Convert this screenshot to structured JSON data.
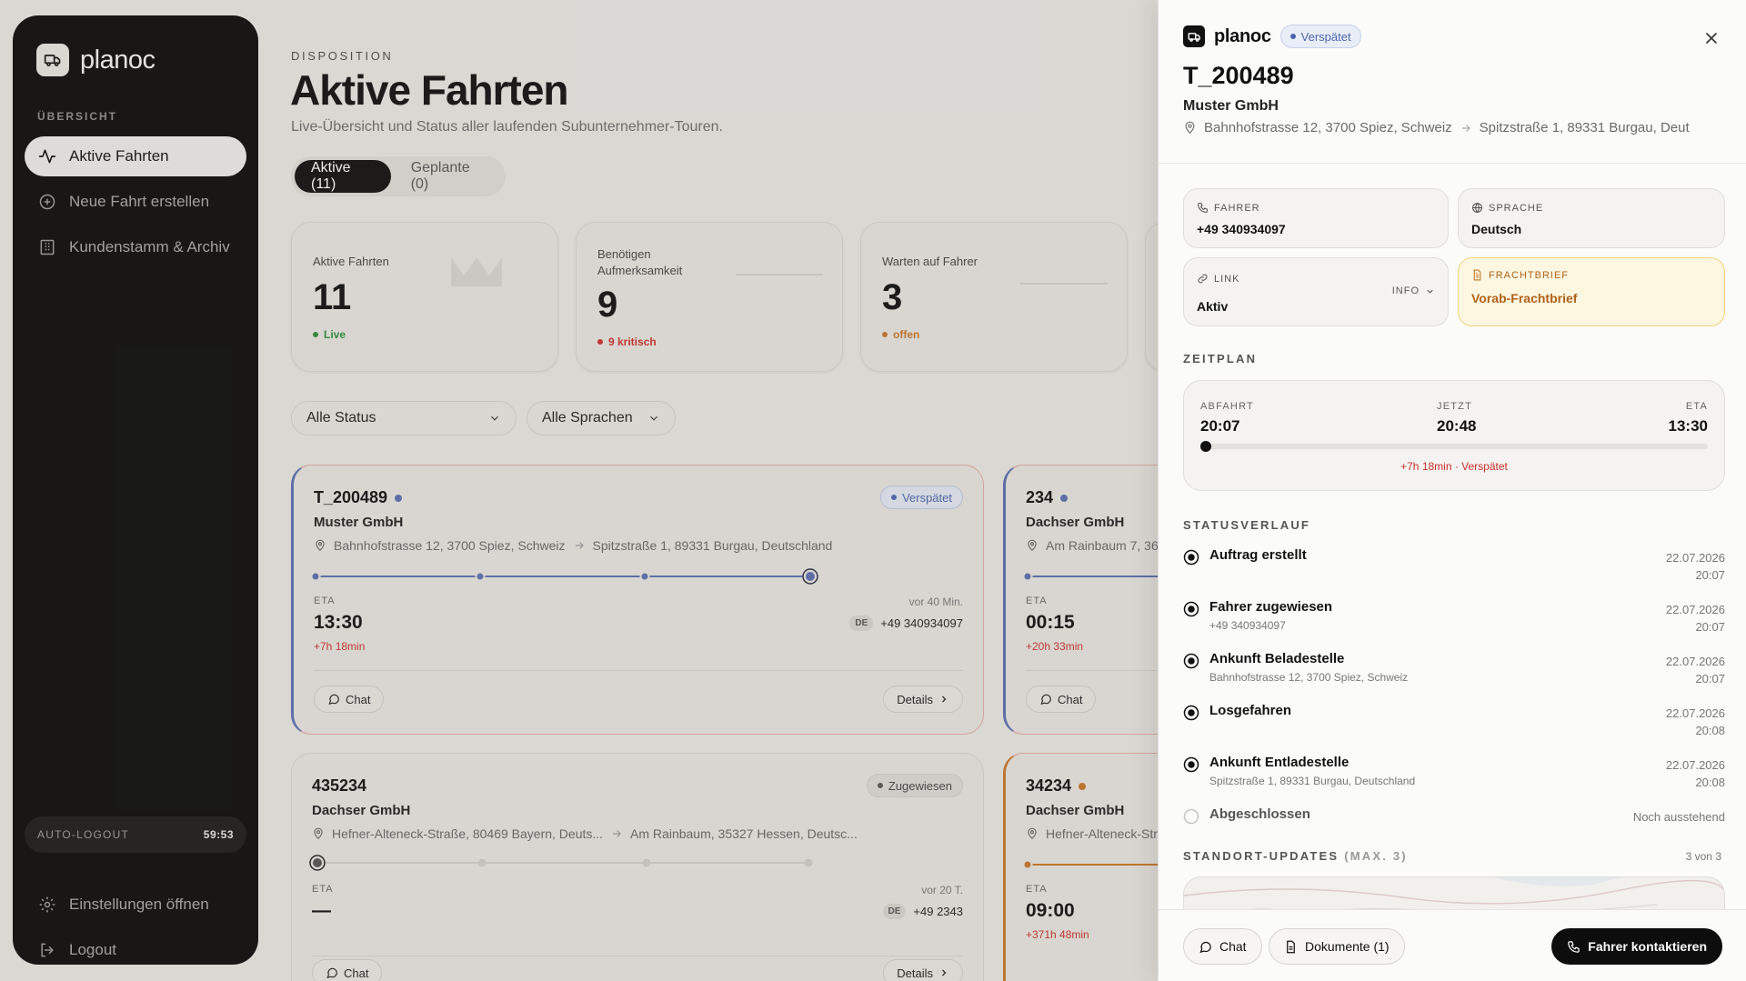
{
  "sidebar": {
    "brand": "planoc",
    "section": "ÜBERSICHT",
    "nav": [
      {
        "label": "Aktive Fahrten"
      },
      {
        "label": "Neue Fahrt erstellen"
      },
      {
        "label": "Kundenstamm & Archiv"
      }
    ],
    "autologout_label": "AUTO-LOGOUT",
    "autologout_time": "59:53",
    "settings": "Einstellungen öffnen",
    "logout": "Logout"
  },
  "main": {
    "kicker": "DISPOSITION",
    "title": "Aktive Fahrten",
    "subtitle": "Live-Übersicht und Status aller laufenden Subunternehmer-Touren.",
    "tabs": [
      "Aktive (11)",
      "Geplante (0)"
    ],
    "stats": [
      {
        "label": "Aktive Fahrten",
        "value": "11",
        "status": "Live",
        "color": "#2e8b3a"
      },
      {
        "label": "Benötigen Aufmerksamkeit",
        "value": "9",
        "status": "9 kritisch",
        "color": "#c9302c"
      },
      {
        "label": "Warten auf Fahrer",
        "value": "3",
        "status": "offen",
        "color": "#c7762a"
      }
    ],
    "filters": [
      "Alle Status",
      "Alle Sprachen"
    ],
    "cards": [
      {
        "id": "T_200489",
        "company": "Muster GmbH",
        "from": "Bahnhofstrasse 12, 3700 Spiez, Schweiz",
        "to": "Spitzstraße 1, 89331 Burgau, Deutschland",
        "badge": "Verspätet",
        "eta_label": "ETA",
        "eta": "13:30",
        "delay": "+7h 18min",
        "ago": "vor 40 Min.",
        "lang": "DE",
        "phone": "+49 340934097",
        "chat": "Chat",
        "details": "Details"
      },
      {
        "id": "234",
        "company": "Dachser GmbH",
        "from": "Am Rainbaum 7, 361",
        "eta_label": "ETA",
        "eta": "00:15",
        "delay": "+20h 33min",
        "chat": "Chat"
      },
      {
        "id": "435234",
        "company": "Dachser GmbH",
        "from": "Hefner-Alteneck-Straße, 80469 Bayern, Deuts...",
        "to": "Am Rainbaum, 35327 Hessen, Deutsc...",
        "badge": "Zugewiesen",
        "eta_label": "ETA",
        "eta": "—",
        "ago": "vor 20 T.",
        "lang": "DE",
        "phone": "+49 2343",
        "chat": "Chat",
        "details": "Details"
      },
      {
        "id": "34234",
        "company": "Dachser GmbH",
        "from": "Hefner-Alteneck-Stra",
        "eta_label": "ETA",
        "eta": "09:00",
        "delay": "+371h 48min"
      }
    ]
  },
  "panel": {
    "brand": "planoc",
    "badge": "Verspätet",
    "id": "T_200489",
    "company": "Muster GmbH",
    "from": "Bahnhofstrasse 12, 3700 Spiez, Schweiz",
    "to": "Spitzstraße 1, 89331 Burgau, Deut",
    "driver_label": "FAHRER",
    "driver": "+49 340934097",
    "language_label": "SPRACHE",
    "language": "Deutsch",
    "link_label": "LINK",
    "link": "Aktiv",
    "info": "INFO",
    "freight_label": "FRACHTBRIEF",
    "freight": "Vorab-Frachtbrief",
    "schedule_title": "ZEITPLAN",
    "departure_label": "ABFAHRT",
    "departure": "20:07",
    "now_label": "JETZT",
    "now": "20:48",
    "eta_label": "ETA",
    "eta": "13:30",
    "progress": 0,
    "delay_text": "+7h 18min · Verspätet",
    "history_title": "STATUSVERLAUF",
    "history": [
      {
        "name": "Auftrag erstellt",
        "sub": "",
        "date": "22.07.2026",
        "time": "20:07"
      },
      {
        "name": "Fahrer zugewiesen",
        "sub": "+49 340934097",
        "date": "22.07.2026",
        "time": "20:07"
      },
      {
        "name": "Ankunft Beladestelle",
        "sub": "Bahnhofstrasse 12, 3700 Spiez, Schweiz",
        "date": "22.07.2026",
        "time": "20:07"
      },
      {
        "name": "Losgefahren",
        "sub": "",
        "date": "22.07.2026",
        "time": "20:08"
      },
      {
        "name": "Ankunft Entladestelle",
        "sub": "Spitzstraße 1, 89331 Burgau, Deutschland",
        "date": "22.07.2026",
        "time": "20:08"
      },
      {
        "name": "Abgeschlossen",
        "sub": "",
        "date": "Noch ausstehend",
        "time": ""
      }
    ],
    "location_title": "STANDORT-UPDATES",
    "location_max": "(MAX. 3)",
    "location_count": "3 von 3",
    "chat": "Chat",
    "documents": "Dokumente (1)",
    "contact": "Fahrer kontaktieren"
  }
}
